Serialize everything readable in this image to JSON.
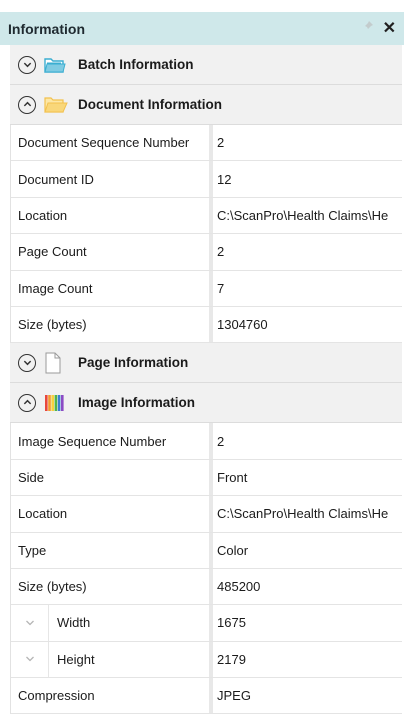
{
  "panel": {
    "title": "Information"
  },
  "sections": {
    "batch": {
      "title": "Batch Information"
    },
    "document": {
      "title": "Document Information",
      "rows": [
        {
          "label": "Document Sequence Number",
          "value": "2"
        },
        {
          "label": "Document ID",
          "value": "12"
        },
        {
          "label": "Location",
          "value": "C:\\ScanPro\\Health Claims\\He"
        },
        {
          "label": "Page Count",
          "value": "2"
        },
        {
          "label": "Image Count",
          "value": "7"
        },
        {
          "label": "Size (bytes)",
          "value": "1304760"
        }
      ]
    },
    "page": {
      "title": "Page Information"
    },
    "image": {
      "title": "Image Information",
      "rows": [
        {
          "label": "Image Sequence Number",
          "value": "2"
        },
        {
          "label": "Side",
          "value": "Front"
        },
        {
          "label": "Location",
          "value": "C:\\ScanPro\\Health Claims\\He"
        },
        {
          "label": "Type",
          "value": "Color"
        },
        {
          "label": "Size (bytes)",
          "value": "485200"
        },
        {
          "label": "Width",
          "value": "1675"
        },
        {
          "label": "Height",
          "value": "2179"
        },
        {
          "label": "Compression",
          "value": "JPEG"
        }
      ]
    }
  },
  "icons": {
    "pin": "pin-icon",
    "close": "close-icon",
    "expand": "chevron-down-circle-icon",
    "collapse": "chevron-up-circle-icon",
    "folder_batch": "folder-icon",
    "folder_document": "folder-open-icon",
    "page": "page-icon",
    "image": "image-bars-icon",
    "sub_expand": "chevron-down-icon"
  },
  "colors": {
    "title_bar": "#cfe8ea",
    "header_bg": "#f1f1f1",
    "batch_folder": "#3aaed1",
    "document_folder": "#f7cf66"
  }
}
